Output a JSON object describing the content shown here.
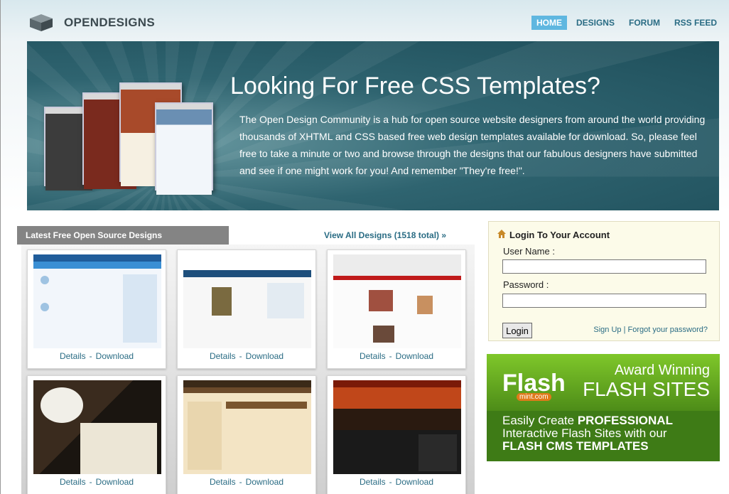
{
  "header": {
    "logo_text": "OPENDESIGNS",
    "nav": [
      {
        "label": "HOME",
        "active": true
      },
      {
        "label": "DESIGNS"
      },
      {
        "label": "FORUM"
      },
      {
        "label": "RSS FEED"
      }
    ]
  },
  "hero": {
    "title": "Looking For Free CSS Templates?",
    "text": "The Open Design Community is a hub for open source website designers from around the world providing thousands of XHTML and CSS based free web design templates available for download. So, please feel free to take a minute or two and browse through the designs that our fabulous designers have submitted and see if one might work for you! And remember \"They're free!\"."
  },
  "latest": {
    "title": "Latest Free Open Source Designs",
    "view_all": "View All Designs (1518 total) »",
    "cards": [
      {
        "details": "Details",
        "download": "Download"
      },
      {
        "details": "Details",
        "download": "Download"
      },
      {
        "details": "Details",
        "download": "Download"
      },
      {
        "details": "Details",
        "download": "Download"
      },
      {
        "details": "Details",
        "download": "Download"
      },
      {
        "details": "Details",
        "download": "Download"
      }
    ],
    "separator": "-"
  },
  "login": {
    "title": "Login To Your Account",
    "username_label": "User Name :",
    "password_label": "Password :",
    "button": "Login",
    "signup": "Sign Up",
    "divider": "|",
    "forgot": "Forgot your password?"
  },
  "ad": {
    "brand": "Flash",
    "brand_sub": "mint.com",
    "award": "Award Winning",
    "sites": "FLASH SITES",
    "line1_pre": "Easily Create ",
    "line1_bold": "PROFESSIONAL",
    "line2": "Interactive Flash Sites with our",
    "line3_bold": "FLASH CMS TEMPLATES"
  }
}
